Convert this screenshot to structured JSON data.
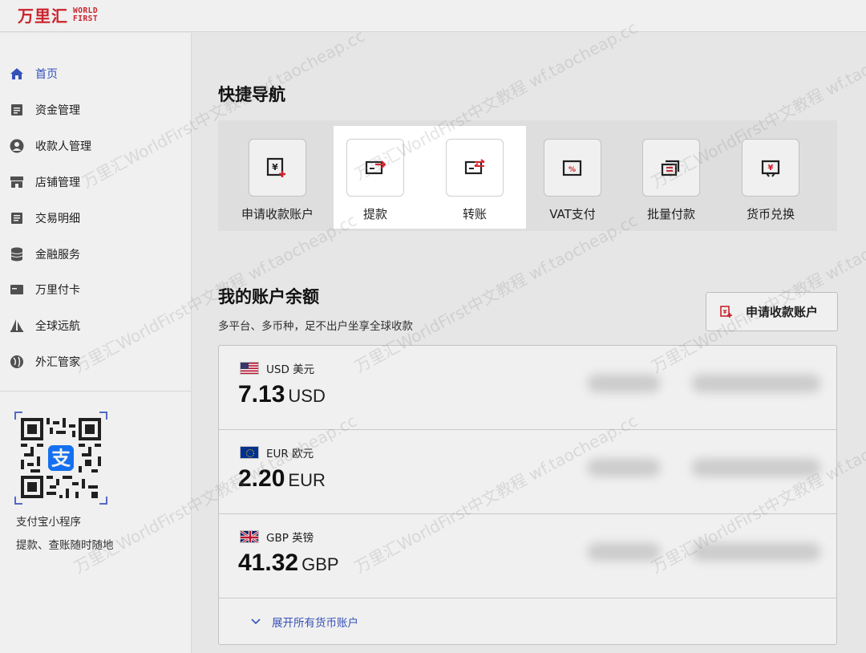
{
  "logo": {
    "cn": "万里汇",
    "en_line1": "WORLD",
    "en_line2": "FIRST"
  },
  "sidebar": {
    "items": [
      {
        "label": "首页",
        "icon": "home-icon",
        "active": true
      },
      {
        "label": "资金管理",
        "icon": "document-icon"
      },
      {
        "label": "收款人管理",
        "icon": "user-icon"
      },
      {
        "label": "店铺管理",
        "icon": "store-icon"
      },
      {
        "label": "交易明细",
        "icon": "list-icon"
      },
      {
        "label": "金融服务",
        "icon": "database-icon"
      },
      {
        "label": "万里付卡",
        "icon": "card-icon"
      },
      {
        "label": "全球远航",
        "icon": "ship-icon"
      },
      {
        "label": "外汇管家",
        "icon": "globe-icon"
      }
    ],
    "qr_caption_1": "支付宝小程序",
    "qr_caption_2": "提款、查账随时随地"
  },
  "quick_nav": {
    "title": "快捷导航",
    "items": [
      {
        "label": "申请收款账户",
        "icon": "receive-account-icon"
      },
      {
        "label": "提款",
        "icon": "withdraw-icon"
      },
      {
        "label": "转账",
        "icon": "transfer-icon"
      },
      {
        "label": "VAT支付",
        "icon": "vat-icon"
      },
      {
        "label": "批量付款",
        "icon": "batch-pay-icon"
      },
      {
        "label": "货币兑换",
        "icon": "exchange-icon"
      }
    ]
  },
  "balance": {
    "title": "我的账户余额",
    "subtitle": "多平台、多币种，足不出户坐享全球收款",
    "apply_button": "申请收款账户",
    "rows": [
      {
        "currency_name": "USD 美元",
        "amount": "7.13",
        "unit": "USD",
        "flag": "us-flag-icon"
      },
      {
        "currency_name": "EUR 欧元",
        "amount": "2.20",
        "unit": "EUR",
        "flag": "eu-flag-icon"
      },
      {
        "currency_name": "GBP 英镑",
        "amount": "41.32",
        "unit": "GBP",
        "flag": "uk-flag-icon"
      }
    ],
    "expand_label": "展开所有货币账户"
  },
  "watermark_text": "万里汇WorldFirst中文教程 wf.taocheap.cc",
  "colors": {
    "brand_red": "#d7262f",
    "accent_blue": "#3a57c4"
  }
}
